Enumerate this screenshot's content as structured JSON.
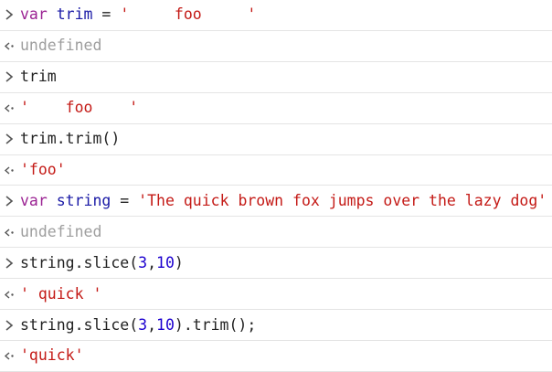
{
  "console": {
    "entries": [
      {
        "kind": "input",
        "tokens": [
          [
            "var",
            "var-kw"
          ],
          [
            " ",
            "op"
          ],
          [
            "trim",
            "ident"
          ],
          [
            " = ",
            "op"
          ],
          [
            "'     foo     '",
            "str"
          ]
        ]
      },
      {
        "kind": "output",
        "tokens": [
          [
            "undefined",
            "undef"
          ]
        ]
      },
      {
        "kind": "input",
        "tokens": [
          [
            "trim",
            "plain"
          ]
        ]
      },
      {
        "kind": "output",
        "tokens": [
          [
            "'    foo    '",
            "res-str"
          ]
        ]
      },
      {
        "kind": "input",
        "tokens": [
          [
            "trim.trim()",
            "plain"
          ]
        ]
      },
      {
        "kind": "output",
        "tokens": [
          [
            "'foo'",
            "res-str"
          ]
        ]
      },
      {
        "kind": "input",
        "tokens": [
          [
            "var",
            "var-kw"
          ],
          [
            " ",
            "op"
          ],
          [
            "string",
            "ident"
          ],
          [
            " = ",
            "op"
          ],
          [
            "'The quick brown fox jumps over the lazy dog'",
            "str"
          ]
        ]
      },
      {
        "kind": "output",
        "tokens": [
          [
            "undefined",
            "undef"
          ]
        ]
      },
      {
        "kind": "input",
        "tokens": [
          [
            "string.slice(",
            "plain"
          ],
          [
            "3",
            "num"
          ],
          [
            ",",
            "plain"
          ],
          [
            "10",
            "num"
          ],
          [
            ")",
            "plain"
          ]
        ]
      },
      {
        "kind": "output",
        "tokens": [
          [
            "' quick '",
            "res-str"
          ]
        ]
      },
      {
        "kind": "input",
        "tokens": [
          [
            "string.slice(",
            "plain"
          ],
          [
            "3",
            "num"
          ],
          [
            ",",
            "plain"
          ],
          [
            "10",
            "num"
          ],
          [
            ").trim();",
            "plain"
          ]
        ]
      },
      {
        "kind": "output",
        "tokens": [
          [
            "'quick'",
            "res-str"
          ]
        ]
      }
    ]
  },
  "icons": {
    "input_prompt": "chevron-right-icon",
    "output_prompt": "return-arrow-icon"
  },
  "colors": {
    "keyword": "#9b2393",
    "identifier": "#1a1aa6",
    "string": "#c41a16",
    "number": "#1c00cf",
    "undefined": "#9e9e9e",
    "prompt": "#555555",
    "divider": "#e4e4e4"
  }
}
